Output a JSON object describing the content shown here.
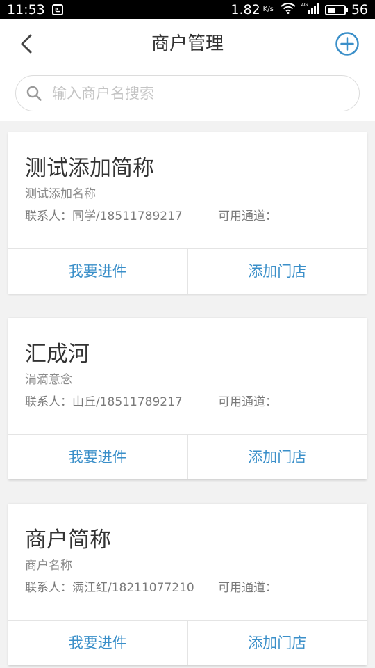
{
  "status_bar": {
    "time": "11:53",
    "notification_icon": "app-notification-icon",
    "net_speed": "1.82",
    "net_speed_unit": "K/s",
    "wifi_icon": "wifi-icon",
    "signal_label": "4G",
    "battery_level": "56"
  },
  "header": {
    "title": "商户管理",
    "back_icon": "chevron-left-icon",
    "add_icon": "plus-circle-icon"
  },
  "search": {
    "placeholder": "输入商户名搜索",
    "value": "",
    "icon": "search-icon"
  },
  "merchants": [
    {
      "short_name": "测试添加简称",
      "full_name": "测试添加名称",
      "contact": "联系人：同学/18511789217",
      "channel": "可用通道：",
      "action_left": "我要进件",
      "action_right": "添加门店"
    },
    {
      "short_name": "汇成河",
      "full_name": "涓滴意念",
      "contact": "联系人：山丘/18511789217",
      "channel": "可用通道：",
      "action_left": "我要进件",
      "action_right": "添加门店"
    },
    {
      "short_name": "商户简称",
      "full_name": "商户名称",
      "contact": "联系人：满江红/18211077210",
      "channel": "可用通道：",
      "action_left": "我要进件",
      "action_right": "添加门店"
    }
  ],
  "colors": {
    "accent": "#3a8fc9",
    "background": "#f2f2f2",
    "card": "#ffffff"
  }
}
